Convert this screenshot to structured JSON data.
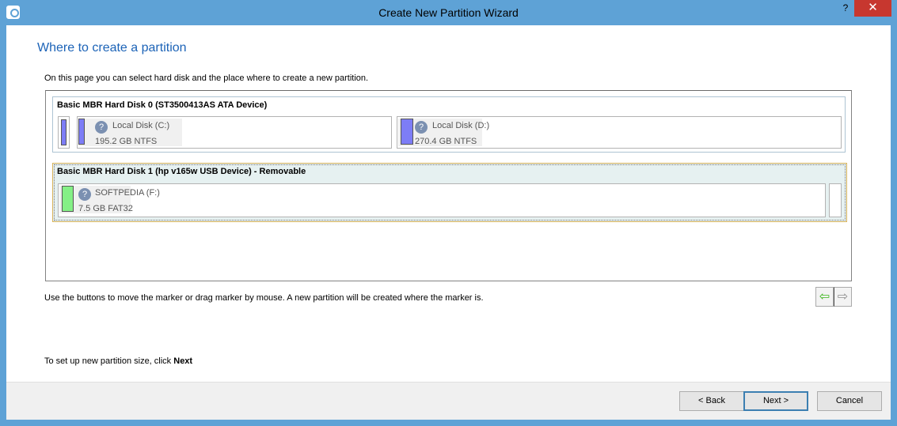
{
  "window": {
    "title": "Create New Partition Wizard",
    "help": "?",
    "close": "✕"
  },
  "page": {
    "heading": "Where to create a partition",
    "intro": "On this page you can select hard disk and the place where to create a new partition.",
    "help_text": "Use the buttons to move the marker or drag marker by mouse. A new partition will be created where the marker is.",
    "next_hint_prefix": "To set up new partition size, click ",
    "next_hint_bold": "Next"
  },
  "disks": [
    {
      "title": "Basic MBR Hard Disk 0 (ST3500413AS ATA Device)",
      "partitions": [
        {
          "name": "Local Disk (C:)",
          "size": "195.2 GB NTFS",
          "color": "#7d7df6"
        },
        {
          "name": "Local Disk (D:)",
          "size": "270.4 GB NTFS",
          "color": "#7d7df6"
        }
      ]
    },
    {
      "title": "Basic MBR Hard Disk 1 (hp v165w USB Device) - Removable",
      "partitions": [
        {
          "name": "SOFTPEDIA (F:)",
          "size": "7.5 GB FAT32",
          "color": "#84f086"
        }
      ]
    }
  ],
  "arrows": {
    "left": "⇦",
    "right": "⇨"
  },
  "buttons": {
    "back": "< Back",
    "next": "Next >",
    "cancel": "Cancel"
  },
  "icons": {
    "partition": "question-icon"
  }
}
